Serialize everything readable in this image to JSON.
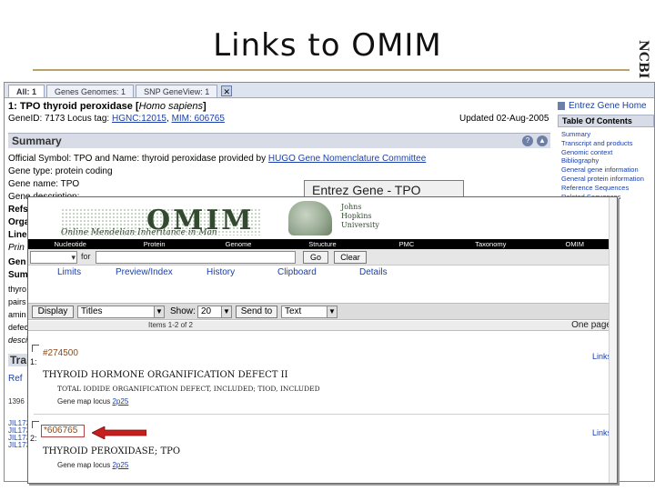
{
  "slide": {
    "title": "Links to OMIM",
    "side_tab": "NCBI"
  },
  "background_window": {
    "tabs": [
      "All: 1",
      "Genes Genomes: 1",
      "SNP GeneView: 1"
    ],
    "close_glyph": "✕",
    "gene_heading_prefix": "1: TPO  thyroid peroxidase [",
    "gene_heading_species": "Homo sapiens",
    "gene_heading_suffix": "]",
    "gene_id_text": "GeneID: 7173   Locus tag: ",
    "locus_tag_link": "HGNC:12015",
    "mim_link": "MIM: 606765",
    "updated": "Updated 02-Aug-2005",
    "summary_label": "Summary",
    "help_glyph": "?",
    "collapse_glyph": "▲",
    "official_symbol_text": "Official Symbol: TPO and Name: thyroid peroxidase provided by ",
    "hgnc_link": "HUGO Gene Nomenclature Committee",
    "gene_type": "Gene type: protein coding",
    "gene_name": "Gene name: TPO",
    "gene_description_stub": "Gene description:",
    "left_stubs": [
      "Refs",
      "Orga",
      "Line",
      "Prin",
      "Gen",
      "Sumr"
    ],
    "body_stubs": [
      "thyro",
      "pairs",
      "amin",
      "defec",
      "desci"
    ],
    "traverse_label": "Tra",
    "ref_stub": "Ref",
    "small_links": [
      "1396",
      "JIL173",
      "JIL173",
      "JIL173",
      "JIL173"
    ],
    "sidebar": {
      "gene_home": "Entrez Gene Home",
      "toc": "Table Of Contents",
      "items": [
        "Summary",
        "Transcript and products",
        "Genomic context",
        "Bibliography",
        "General gene information",
        "General protein information",
        "Reference Sequences",
        "Related Sequences"
      ],
      "bottom_items": [
        "ee",
        "se",
        "e",
        "e"
      ]
    }
  },
  "tpo_window": {
    "title": "Entrez Gene - TPO"
  },
  "omim": {
    "logo": "OMIM",
    "logo_sub": "Online Mendelian Inheritance in Man",
    "university": [
      "Johns",
      "Hopkins",
      "University"
    ],
    "nav": [
      "Nucleotide",
      "Protein",
      "Genome",
      "Structure",
      "PMC",
      "Taxonomy",
      "OMIM"
    ],
    "search": {
      "db_value": "",
      "for_label": "for",
      "query_value": "",
      "go_label": "Go",
      "clear_label": "Clear"
    },
    "subnav": [
      "Limits",
      "Preview/Index",
      "History",
      "Clipboard",
      "Details"
    ],
    "display_button": "Display",
    "format_value": "Titles",
    "show_label": "Show:",
    "show_value": "20",
    "send_button": "Send to",
    "send_value": "Text",
    "items_count": "Items 1-2 of 2",
    "page_label": "One page",
    "entries": [
      {
        "number": "1:",
        "id": "#274500",
        "links": "Links",
        "title": "THYROID HORMONE ORGANIFICATION DEFECT II",
        "alt": "TOTAL IODIDE ORGANIFICATION DEFECT, INCLUDED; TIOD, INCLUDED",
        "map_prefix": "Gene map locus ",
        "map_locus": "2p25"
      },
      {
        "number": "2:",
        "id": "*606765",
        "links": "Links",
        "title": "THYROID PEROXIDASE; TPO",
        "alt": "",
        "map_prefix": "Gene map locus ",
        "map_locus": "2p25"
      }
    ]
  },
  "colors": {
    "arrow": "#c81e1e",
    "omim_green": "#324a2e",
    "link_blue": "#1a3fa8",
    "title_rule": "#b9a36a"
  }
}
